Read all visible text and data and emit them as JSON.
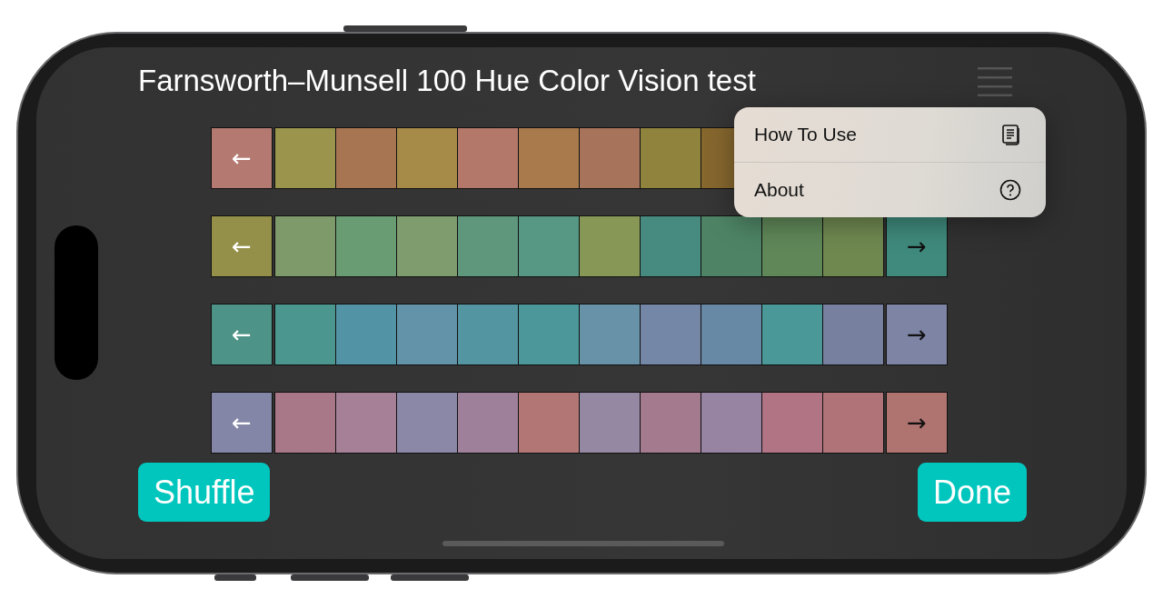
{
  "title": "Farnsworth–Munsell 100 Hue Color Vision test",
  "rows": [
    {
      "left": {
        "label": "←",
        "color": "#b47a72"
      },
      "tiles": [
        {
          "color": "#9a944c"
        },
        {
          "color": "#a87552"
        },
        {
          "color": "#a68b48"
        },
        {
          "color": "#b3786a"
        },
        {
          "color": "#a87a4c"
        },
        {
          "color": "#a7735a"
        },
        {
          "color": "#8f833e"
        },
        {
          "color": "#86672e"
        }
      ]
    },
    {
      "left": {
        "label": "←",
        "color": "#949049"
      },
      "tiles": [
        {
          "color": "#7f9a6a"
        },
        {
          "color": "#6a9c74"
        },
        {
          "color": "#7f9c6e"
        },
        {
          "color": "#5e977c"
        },
        {
          "color": "#579884"
        },
        {
          "color": "#879856"
        },
        {
          "color": "#468a80"
        },
        {
          "color": "#4e8465"
        },
        {
          "color": "#5f8758"
        },
        {
          "color": "#6f8850"
        }
      ],
      "right": {
        "label": "→",
        "color": "#3f8a7c"
      }
    },
    {
      "left": {
        "label": "←",
        "color": "#4e9387"
      },
      "tiles": [
        {
          "color": "#4b978f"
        },
        {
          "color": "#5294a6"
        },
        {
          "color": "#6393a8"
        },
        {
          "color": "#5495a2"
        },
        {
          "color": "#4b979a"
        },
        {
          "color": "#6892a8"
        },
        {
          "color": "#7587a6"
        },
        {
          "color": "#6889a6"
        },
        {
          "color": "#4a9898"
        },
        {
          "color": "#7880a0"
        }
      ],
      "right": {
        "label": "→",
        "color": "#7d84a4"
      }
    },
    {
      "left": {
        "label": "←",
        "color": "#8386a6"
      },
      "tiles": [
        {
          "color": "#a97888"
        },
        {
          "color": "#a58096"
        },
        {
          "color": "#8b87a6"
        },
        {
          "color": "#9e809a"
        },
        {
          "color": "#b27774"
        },
        {
          "color": "#9588a2"
        },
        {
          "color": "#a47a8e"
        },
        {
          "color": "#9784a2"
        },
        {
          "color": "#b07484"
        },
        {
          "color": "#b07478"
        }
      ],
      "right": {
        "label": "→",
        "color": "#b07470"
      }
    }
  ],
  "menu": {
    "items": [
      {
        "label": "How To Use",
        "kind": "document"
      },
      {
        "label": "About",
        "kind": "help"
      }
    ]
  },
  "buttons": [
    {
      "label": "Shuffle"
    },
    {
      "label": "Done"
    }
  ]
}
